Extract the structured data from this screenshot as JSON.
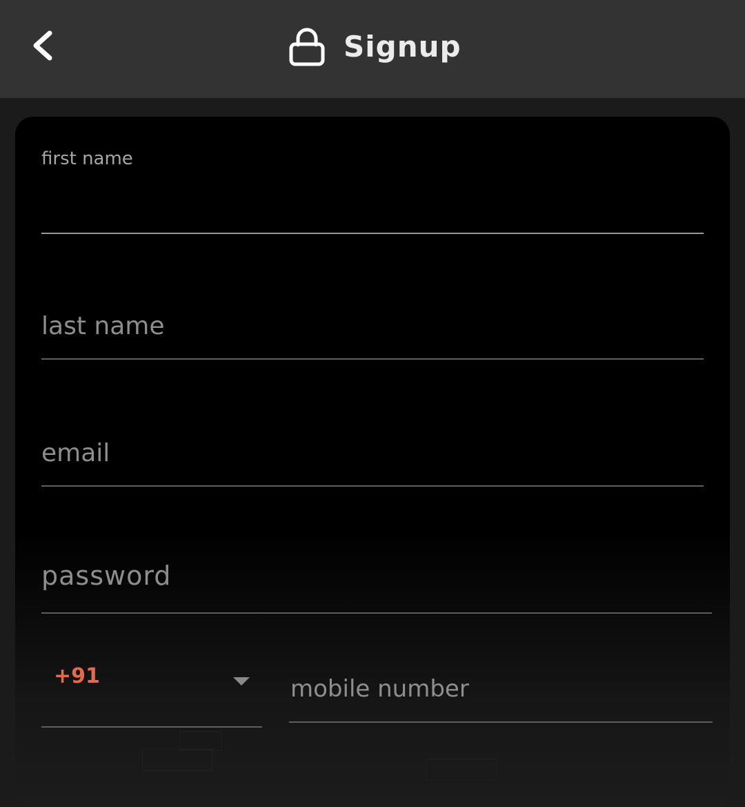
{
  "app_bar": {
    "title": "Signup",
    "back_icon": "chevron-left-icon",
    "title_icon": "lock-icon",
    "background": "#333333"
  },
  "form": {
    "first_name": {
      "label": "first name",
      "value": ""
    },
    "last_name": {
      "label": "last name",
      "value": ""
    },
    "email": {
      "label": "email",
      "value": ""
    },
    "password": {
      "label": "password",
      "value": ""
    },
    "country_code": {
      "value": "+91",
      "icon": "dropdown-arrow-icon",
      "color": "#e56a4c"
    },
    "mobile_number": {
      "label": "mobile number",
      "value": ""
    }
  },
  "colors": {
    "page_background": "#1b1b1b",
    "card_background": "#000000",
    "label_text": "#8e8e8e",
    "title_text": "#ebebeb",
    "accent": "#e56a4c"
  }
}
